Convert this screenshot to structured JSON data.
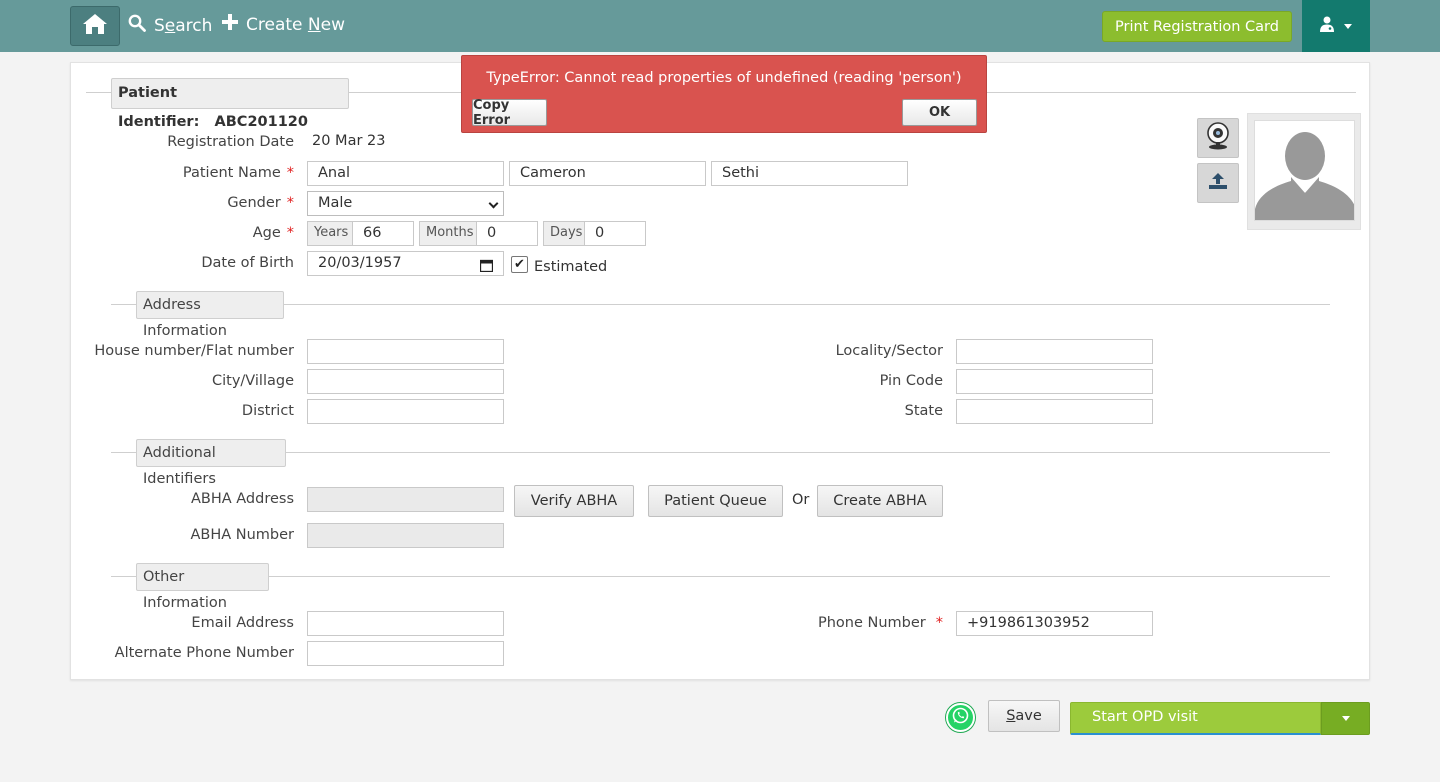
{
  "nav": {
    "search_label": "Search",
    "search_accel": "e",
    "create_label_prefix": "Create ",
    "create_accel": "N",
    "create_label_suffix": "ew",
    "print_card_label": "Print Registration Card"
  },
  "error": {
    "message": "TypeError: Cannot read properties of undefined (reading 'person')",
    "copy_label": "Copy Error",
    "ok_label": "OK"
  },
  "patient": {
    "identifier_label": "Patient Identifier:",
    "identifier_value": "ABC201120",
    "registration_date_label": "Registration Date",
    "registration_date_value": "20 Mar 23",
    "name_label": "Patient Name",
    "first_name": "Anal",
    "middle_name": "Cameron",
    "last_name": "Sethi",
    "gender_label": "Gender",
    "gender_value": "Male",
    "age_label": "Age",
    "years_label": "Years",
    "years_value": "66",
    "months_label": "Months",
    "months_value": "0",
    "days_label": "Days",
    "days_value": "0",
    "dob_label": "Date of Birth",
    "dob_value": "20/03/1957",
    "estimated_label": "Estimated",
    "estimated_checked": true,
    "required_mark": "*"
  },
  "address": {
    "section_title": "Address Information",
    "house_label": "House number/Flat number",
    "city_label": "City/Village",
    "district_label": "District",
    "locality_label": "Locality/Sector",
    "pin_label": "Pin Code",
    "state_label": "State"
  },
  "identifiers": {
    "section_title": "Additional Identifiers",
    "abha_address_label": "ABHA Address",
    "abha_number_label": "ABHA Number",
    "verify_label": "Verify ABHA",
    "queue_label": "Patient Queue",
    "or_label": "Or",
    "create_label": "Create ABHA"
  },
  "other": {
    "section_title": "Other Information",
    "email_label": "Email Address",
    "alt_phone_label": "Alternate Phone Number",
    "phone_label": "Phone Number",
    "phone_value": "+919861303952"
  },
  "footer": {
    "save_accel": "S",
    "save_rest": "ave",
    "start_opd_label": "Start OPD visit"
  },
  "colors": {
    "topbar": "#669a9a",
    "accent_green": "#9ccb3c",
    "error_red": "#d9534f",
    "user_menu": "#137a6e"
  },
  "icons": [
    "home-icon",
    "search-icon",
    "plus-icon",
    "user-doctor-icon",
    "webcam-icon",
    "upload-icon",
    "avatar-placeholder-icon",
    "whatsapp-icon",
    "caret-down-icon"
  ]
}
